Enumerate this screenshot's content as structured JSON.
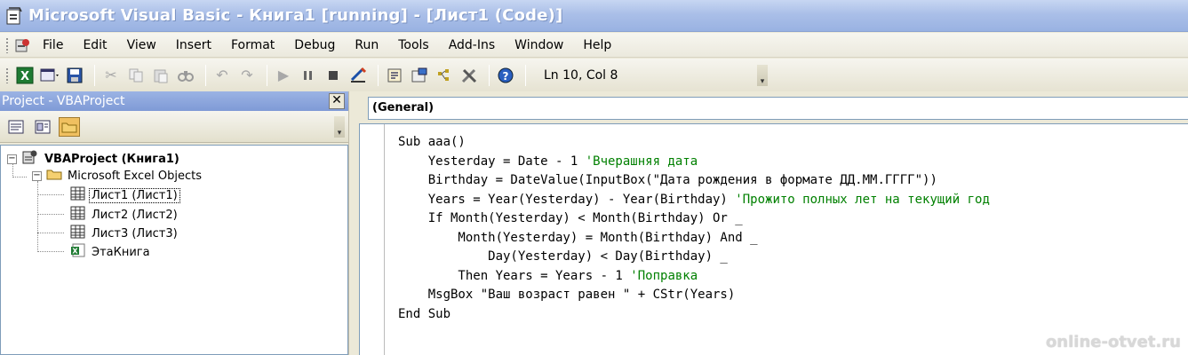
{
  "window": {
    "title": "Microsoft Visual Basic - Книга1 [running] - [Лист1 (Code)]"
  },
  "menu": {
    "items": [
      "File",
      "Edit",
      "View",
      "Insert",
      "Format",
      "Debug",
      "Run",
      "Tools",
      "Add-Ins",
      "Window",
      "Help"
    ]
  },
  "toolbar": {
    "status": "Ln 10, Col 8"
  },
  "project": {
    "title": "Project - VBAProject",
    "close": "✕",
    "root": "VBAProject (Книга1)",
    "folder": "Microsoft Excel Objects",
    "items": [
      "Лист1 (Лист1)",
      "Лист2 (Лист2)",
      "Лист3 (Лист3)",
      "ЭтаКнига"
    ]
  },
  "code": {
    "object_combo": "(General)",
    "lines": [
      {
        "code": "Sub aaa()",
        "comment": ""
      },
      {
        "code": "    Yesterday = Date - 1 ",
        "comment": "'Вчерашняя дата"
      },
      {
        "code": "    Birthday = DateValue(InputBox(\"Дата рождения в формате ДД.ММ.ГГГГ\"))",
        "comment": ""
      },
      {
        "code": "    Years = Year(Yesterday) - Year(Birthday) ",
        "comment": "'Прожито полных лет на текущий год"
      },
      {
        "code": "    If Month(Yesterday) < Month(Birthday) Or _",
        "comment": ""
      },
      {
        "code": "        Month(Yesterday) = Month(Birthday) And _",
        "comment": ""
      },
      {
        "code": "            Day(Yesterday) < Day(Birthday) _",
        "comment": ""
      },
      {
        "code": "        Then Years = Years - 1 ",
        "comment": "'Поправка"
      },
      {
        "code": "    MsgBox \"Ваш возраст равен \" + CStr(Years)",
        "comment": ""
      },
      {
        "code": "End Sub",
        "comment": ""
      }
    ]
  },
  "watermark": "online-otvet.ru",
  "colors": {
    "comment": "#008000",
    "title_text": "#ffffff",
    "selection_button": "#f0c060"
  }
}
